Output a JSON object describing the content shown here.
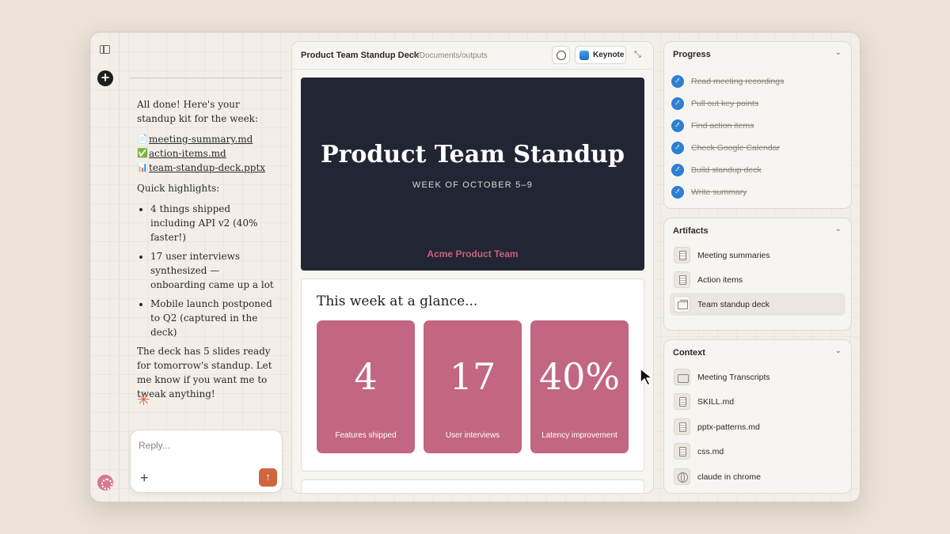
{
  "chat": {
    "intro": "All done! Here's your standup kit for the week:",
    "files": [
      {
        "icon": "document-icon",
        "glyph": "📄",
        "name": "meeting-summary.md"
      },
      {
        "icon": "checkmark-icon",
        "glyph": "✅",
        "name": "action-items.md"
      },
      {
        "icon": "bar-chart-icon",
        "glyph": "📊",
        "name": "team-standup-deck.pptx"
      }
    ],
    "highlights_heading": "Quick highlights:",
    "highlights": [
      "4 things shipped including API v2 (40% faster!)",
      "17 user interviews synthesized — onboarding came up a lot",
      "Mobile launch postponed to Q2 (captured in the deck)"
    ],
    "closing": "The deck has 5 slides ready for tomorrow's standup. Let me know if you want me to tweak anything!",
    "reply_placeholder": "Reply..."
  },
  "preview": {
    "title": "Product Team Standup Deck",
    "path": "· ~/Documents/outputs",
    "keynote_label": "Keynote",
    "slide1": {
      "title": "Product Team Standup",
      "subtitle": "WEEK OF OCTOBER 5–9",
      "team": "Acme Product Team"
    },
    "slide2": {
      "title": "This week at a glance...",
      "stats": [
        {
          "value": "4",
          "label": "Features shipped"
        },
        {
          "value": "17",
          "label": "User interviews"
        },
        {
          "value": "40%",
          "label": "Latency improvement"
        }
      ]
    }
  },
  "progress": {
    "title": "Progress",
    "tasks": [
      "Read meeting recordings",
      "Pull out key points",
      "Find action items",
      "Check Google Calendar",
      "Build standup deck",
      "Write summary"
    ]
  },
  "artifacts": {
    "title": "Artifacts",
    "items": [
      "Meeting summaries",
      "Action items",
      "Team standup deck"
    ]
  },
  "context": {
    "title": "Context",
    "items": [
      "Meeting Transcripts",
      "SKILL.md",
      "pptx-patterns.md",
      "css.md",
      "claude in chrome"
    ]
  },
  "colors": {
    "accent_send": "#d0663d",
    "slide_dark": "#222634",
    "stat_pink": "#c26682",
    "check_blue": "#2a7fd6"
  }
}
